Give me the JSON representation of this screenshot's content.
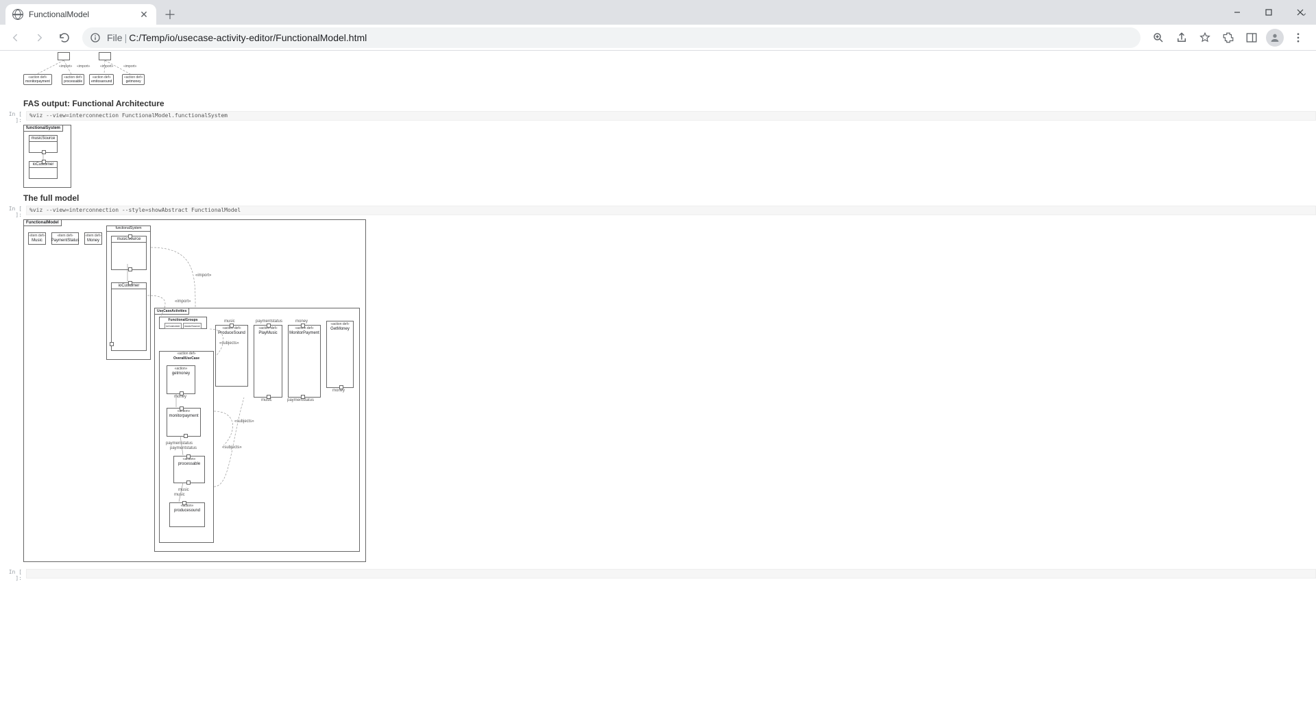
{
  "browser": {
    "tab_title": "FunctionalModel",
    "url_scheme": "File",
    "url_path": "C:/Temp/io/usecase-activity-editor/FunctionalModel.html"
  },
  "top_imports": {
    "import_label": "«import»",
    "leaves": [
      {
        "stereo": "«action def»",
        "name": "monitorpayment"
      },
      {
        "stereo": "«action def»",
        "name": "processable"
      },
      {
        "stereo": "«action def»",
        "name": "emitosaround"
      },
      {
        "stereo": "«action def»",
        "name": "getmoney"
      }
    ]
  },
  "section1": {
    "title": "FAS output: Functional Architecture",
    "prompt": "In [ ]:",
    "code": "%viz --view=interconnection FunctionalModel.functionalSystem",
    "diagram": {
      "frame": "functionalSystem",
      "block_a": "musicSource",
      "block_b": "ioCustomer"
    }
  },
  "section2": {
    "title": "The full model",
    "prompt": "In [ ]:",
    "code": "%viz --view=interconnection --style=showAbstract FunctionalModel",
    "diagram": {
      "frame": "FunctionalModel",
      "itemdefs": [
        {
          "stereo": "«item def»",
          "name": "Music"
        },
        {
          "stereo": "«item def»",
          "name": "PaymentStatus"
        },
        {
          "stereo": "«item def»",
          "name": "Money"
        }
      ],
      "functionalSystem": {
        "label": "functionalSystem",
        "musicSource": "musicSource",
        "ioCustomer": "ioCustomer"
      },
      "imports_label": "«import»",
      "usecase_frame": "UseCaseActivities",
      "functional_groups": "FunctionalGroups",
      "group_parts": [
        "ioCustomer",
        "musicSource"
      ],
      "action_defs": [
        {
          "stereo": "«action def»",
          "name": "OverallUseCase"
        },
        {
          "stereo": "«action def»",
          "name": "ProduceSound",
          "inport": "music"
        },
        {
          "stereo": "«action def»",
          "name": "PlayMusic",
          "inport": "paymentstatus",
          "outport": "music"
        },
        {
          "stereo": "«action def»",
          "name": "MonitorPayment",
          "inport": "money",
          "outport": "paymentstatus"
        },
        {
          "stereo": "«action def»",
          "name": "GetMoney",
          "outport": "money"
        }
      ],
      "flow_actions": [
        {
          "stereo": "«action»",
          "name": "getmoney",
          "out": "money"
        },
        {
          "stereo": "«action»",
          "name": "monitorpayment",
          "out": "paymentstatus"
        },
        {
          "stereo": "«action»",
          "name": "processable",
          "in": "paymentstatus",
          "out": "music"
        },
        {
          "stereo": "«action»",
          "name": "producesound",
          "in": "music"
        }
      ],
      "subjects_label": "«subjects»"
    }
  },
  "bottom_prompt": "In [ ]:"
}
